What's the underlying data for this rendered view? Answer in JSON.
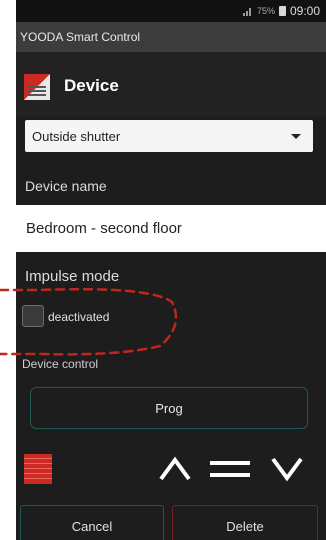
{
  "status_bar": {
    "battery_percent": "75%",
    "time": "09:00"
  },
  "app_name": "YOODA Smart Control",
  "action_bar": {
    "title": "Device",
    "icon": "shutter-app-icon"
  },
  "device_type": {
    "selected": "Outside shutter"
  },
  "device_name": {
    "label": "Device name",
    "value": "Bedroom - second floor"
  },
  "impulse_mode": {
    "label": "Impulse mode",
    "checkbox_label": "deactivated",
    "checked": false
  },
  "device_control": {
    "label": "Device control",
    "prog_label": "Prog"
  },
  "controls": {
    "up": "up-arrow-icon",
    "stop": "stop-icon",
    "down": "down-arrow-icon"
  },
  "footer": {
    "cancel_label": "Cancel",
    "delete_label": "Delete"
  },
  "colors": {
    "accent_red": "#cc2a22",
    "callout": "#c0261e",
    "teal_border": "#1d5a55",
    "delete_border": "#7a2020"
  }
}
